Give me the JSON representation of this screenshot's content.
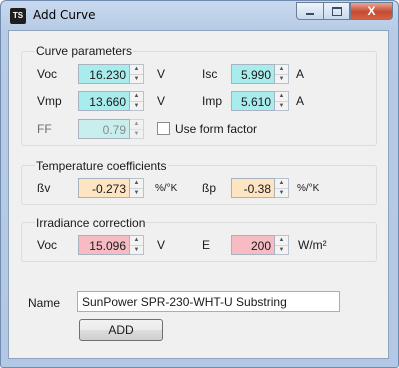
{
  "window": {
    "title": "Add Curve",
    "icon_text": "TS",
    "caption_buttons": {
      "minimize": "minimize-icon",
      "maximize": "maximize-icon",
      "close": "X"
    }
  },
  "curve_parameters": {
    "legend": "Curve parameters",
    "voc": {
      "label": "Voc",
      "value": "16.230",
      "unit": "V"
    },
    "isc": {
      "label": "Isc",
      "value": "5.990",
      "unit": "A"
    },
    "vmp": {
      "label": "Vmp",
      "value": "13.660",
      "unit": "V"
    },
    "imp": {
      "label": "Imp",
      "value": "5.610",
      "unit": "A"
    },
    "ff": {
      "label": "FF",
      "value": "0.79",
      "enabled": false
    },
    "use_form_factor": {
      "label": "Use form factor",
      "checked": false
    }
  },
  "temperature_coefficients": {
    "legend": "Temperature coefficients",
    "beta_v": {
      "label": "ßv",
      "value": "-0.273",
      "unit": "%/°K"
    },
    "beta_p": {
      "label": "ßp",
      "value": "-0.38",
      "unit": "%/°K"
    }
  },
  "irradiance_correction": {
    "legend": "Irradiance correction",
    "voc": {
      "label": "Voc",
      "value": "15.096",
      "unit": "V"
    },
    "e": {
      "label": "E",
      "value": "200",
      "unit": "W/m²"
    }
  },
  "name": {
    "label": "Name",
    "value": "SunPower SPR-230-WHT-U Substring"
  },
  "add_button": {
    "label": "ADD"
  },
  "colors": {
    "teal_field": "#a9eced",
    "peach_field": "#fde4c2",
    "pink_field": "#f7bcc3",
    "dialog_bg": "#f0f0f0",
    "close_button": "#c74a2f"
  }
}
